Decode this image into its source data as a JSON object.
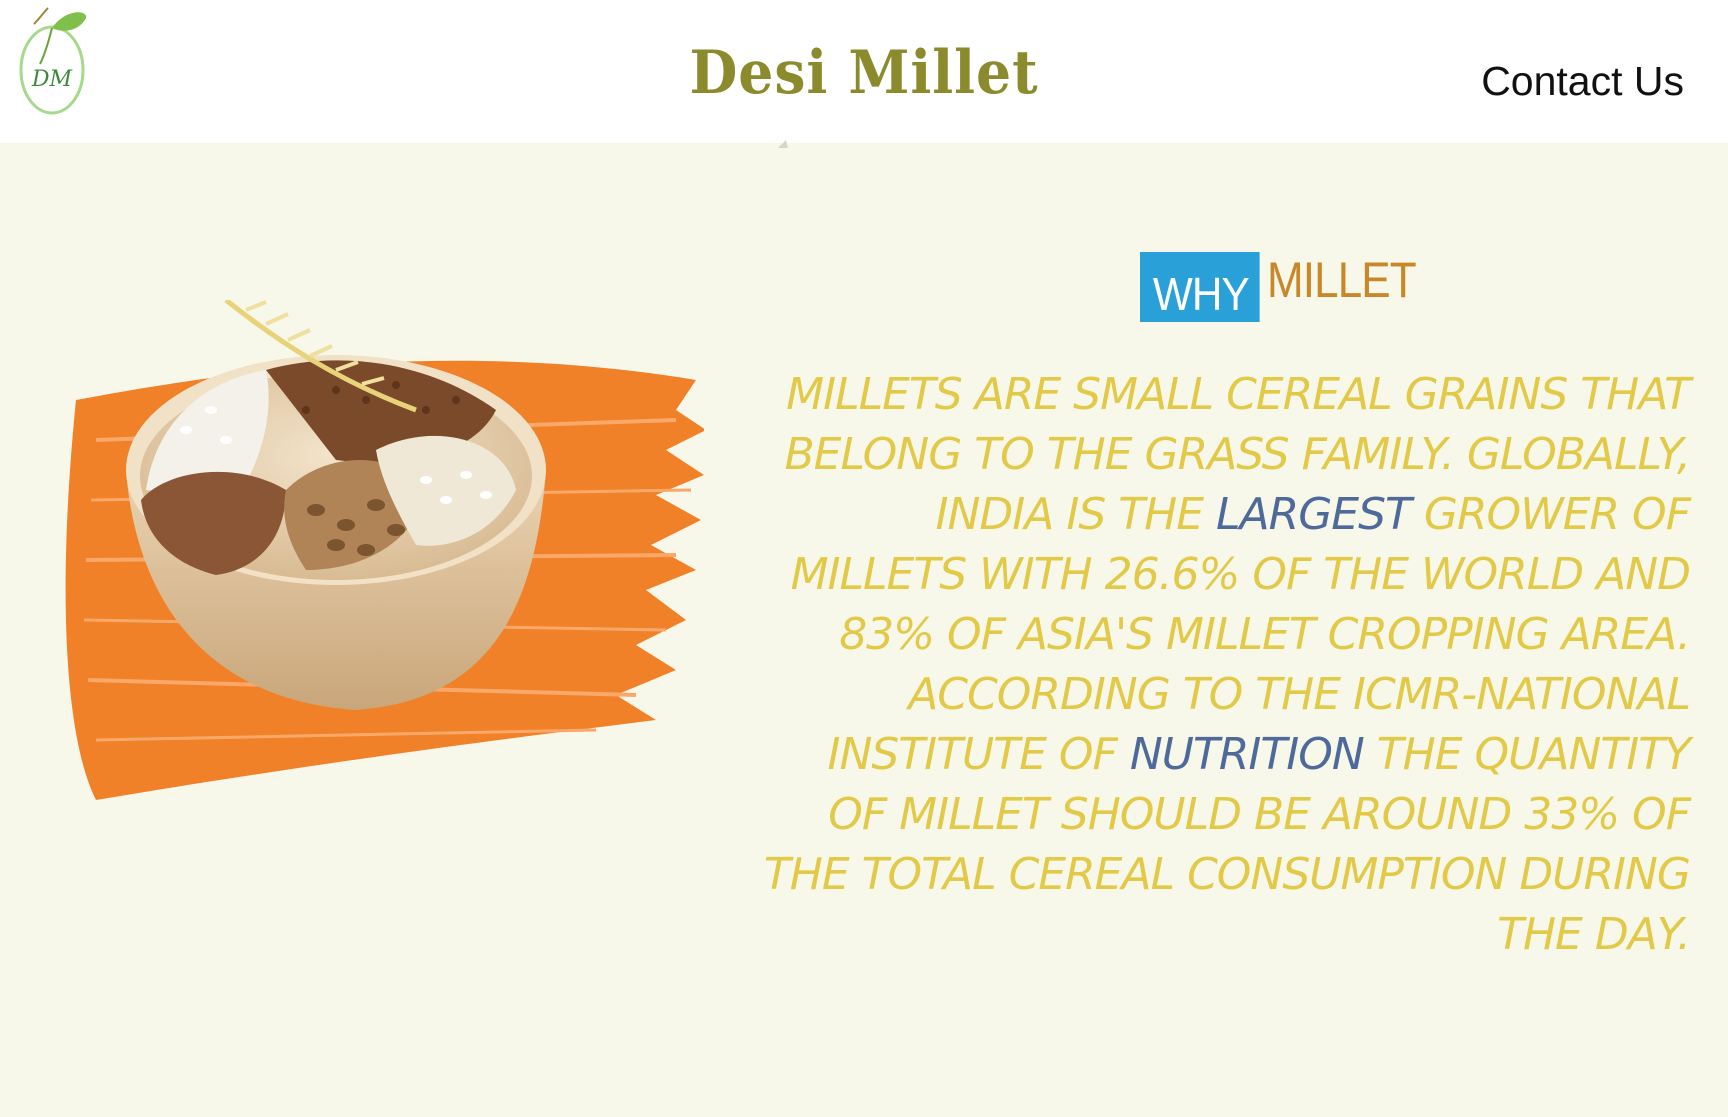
{
  "header": {
    "logo_text": "DM",
    "brand": "Desi Millet",
    "contact_label": "Contact Us"
  },
  "section": {
    "badge": "WHY",
    "title": "MILLET"
  },
  "body": {
    "p1": "Millets are small cereal grains that belong to the grass family. Globally, India is the ",
    "hl1": "largest",
    "p2": " grower of millets with 26.6% of the world and 83% of Asia's millet cropping area. According to the ICMR-National Institute of ",
    "hl2": "nutrition",
    "p3": " the quantity of millet should be around 33% of the total cereal consumption during the day."
  },
  "colors": {
    "background": "#f8f8ea",
    "brand": "#8b8a2c",
    "badge_bg": "#2aa0d8",
    "title": "#c8882a",
    "body": "#e2c948",
    "highlight": "#4d6a9a",
    "brush": "#f07a1e"
  },
  "icons": {
    "logo": "leaf-logo-icon",
    "hero": "millet-bowl-image"
  }
}
